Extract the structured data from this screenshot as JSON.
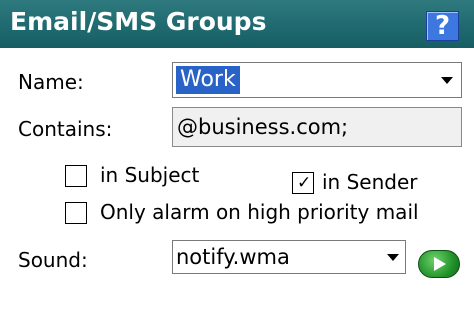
{
  "title": "Email/SMS Groups",
  "help_label": "?",
  "form": {
    "name_label": "Name:",
    "name_value": "Work",
    "contains_label": "Contains:",
    "contains_value": "@business.com;",
    "in_subject_label": "in Subject",
    "in_subject_checked": false,
    "in_sender_label": "in Sender",
    "in_sender_checked": true,
    "high_priority_label": "Only alarm on high priority mail",
    "high_priority_checked": false,
    "sound_label": "Sound:",
    "sound_value": "notify.wma"
  },
  "colors": {
    "titlebar": "#1f6a70",
    "selection": "#2a63c8",
    "play_button": "#1f8f27",
    "help_button": "#3d78e0"
  }
}
